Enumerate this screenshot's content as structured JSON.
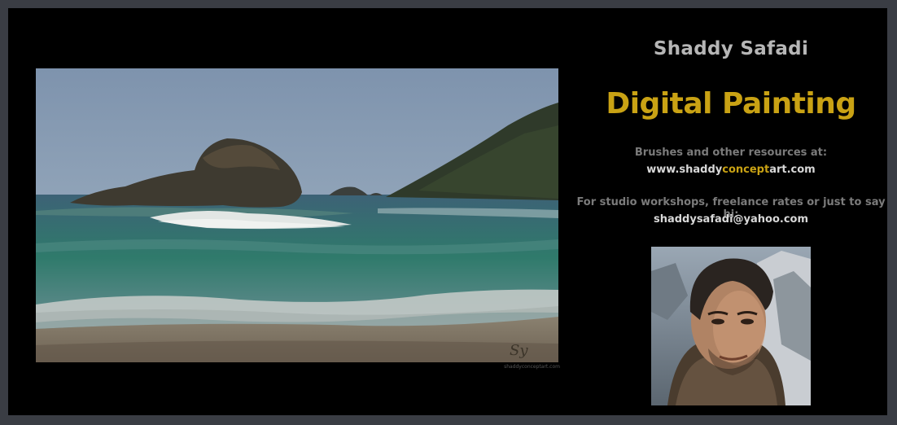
{
  "artist_name": "Shaddy Safadi",
  "title": "Digital Painting",
  "resources": {
    "label": "Brushes and other resources at:",
    "url_part1": "www.shaddy",
    "url_highlight": "concept",
    "url_part2": "art.com"
  },
  "contact": {
    "label": "For studio workshops, freelance rates or just to say hi:",
    "email": "shaddysafadi@yahoo.com"
  },
  "painting": {
    "icon": "seascape-painting",
    "signature": "Sy",
    "watermark": "shaddyconceptart.com"
  },
  "portrait": {
    "icon": "artist-portrait-photo"
  },
  "colors": {
    "background": "#000000",
    "frame": "#3a3d44",
    "accent": "#c9a214",
    "name_text": "#b6b6b6",
    "muted_text": "#7b7b7b",
    "bright_text": "#d8d8d8"
  }
}
